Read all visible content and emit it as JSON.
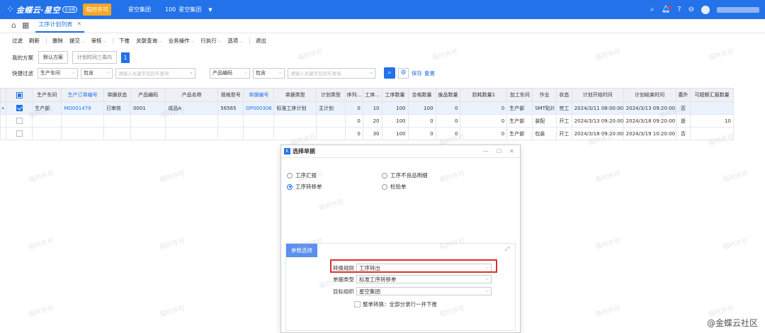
{
  "topbar": {
    "brand": "金蝶云·星空",
    "edition": "企业版",
    "temp_license": "临时许可",
    "org_link": "星空集团",
    "org_code": "100",
    "org_name": "星空集团"
  },
  "tabs": {
    "active": "工序计划列表"
  },
  "toolbar": [
    {
      "label": "过滤",
      "caret": false
    },
    {
      "label": "刷新",
      "caret": false
    },
    {
      "label": "删除",
      "caret": false
    },
    {
      "label": "提交",
      "caret": true
    },
    {
      "label": "审核",
      "caret": true
    },
    {
      "label": "下推",
      "caret": false
    },
    {
      "label": "关联查询",
      "caret": true
    },
    {
      "label": "业务操作",
      "caret": true
    },
    {
      "label": "行执行",
      "caret": true
    },
    {
      "label": "选项",
      "caret": true
    },
    {
      "label": "退出",
      "caret": false
    }
  ],
  "scheme": {
    "label": "我的方案",
    "default": "默认方案",
    "plan": "计划时间三周内",
    "count": "1"
  },
  "quick_filter": {
    "label": "快捷过滤",
    "field1": "生产车间",
    "op1": "包含",
    "ph1": "请输入关键字后回车查询",
    "field2": "产品编码",
    "op2": "包含",
    "ph2": "请输入关键字后回车查询",
    "save": "保存",
    "reset": "重置"
  },
  "grid": {
    "headers": [
      "生产车间",
      "生产订单编号",
      "单据状态",
      "产品编码",
      "产品名称",
      "规格型号",
      "单据编号",
      "单据类型",
      "计划类型",
      "序列...",
      "工序...",
      "工序数量",
      "合格数量",
      "废品数量",
      "损耗数量1",
      "加工车间",
      "作业",
      "状态",
      "计划开始时间",
      "计划结束时间",
      "委外",
      "可超额汇报数量"
    ],
    "rows": [
      [
        "生产部",
        "MO001479",
        "已审核",
        "0001",
        "成品A",
        "56565",
        "OP000306",
        "标准工序计划",
        "主计划",
        "0",
        "10",
        "100",
        "100",
        "0",
        "0",
        "生产部",
        "SMT贴片",
        "完工",
        "2024/3/11 08:00:00",
        "2024/3/13 09:20:00",
        "否",
        ""
      ],
      [
        "",
        "",
        "",
        "",
        "",
        "",
        "",
        "",
        "",
        "0",
        "20",
        "100",
        "0",
        "0",
        "0",
        "生产部",
        "装配",
        "开工",
        "2024/3/13 09:20:00",
        "2024/3/18 09:20:00",
        "是",
        "10"
      ],
      [
        "",
        "",
        "",
        "",
        "",
        "",
        "",
        "",
        "",
        "0",
        "30",
        "100",
        "0",
        "0",
        "0",
        "生产部",
        "包装",
        "开工",
        "2024/3/18 09:20:00",
        "2024/3/19 10:20:00",
        "否",
        ""
      ]
    ]
  },
  "dialog": {
    "title": "选择单据",
    "options": [
      "工序汇报",
      "工序不良品明细",
      "工序转移单",
      "检验单"
    ],
    "selected": "工序转移单",
    "param_tab": "参数选择",
    "rule_label": "转换规则",
    "rule_value": "工序转出",
    "type_label": "单据类型",
    "type_value": "标准工序转移单",
    "org_label": "目标组织",
    "org_value": "星空集团",
    "whole_check": "整单转换：全部分录行一并下推"
  },
  "watermark_text": "临时许可",
  "footer_watermark": "@金蝶云社区"
}
